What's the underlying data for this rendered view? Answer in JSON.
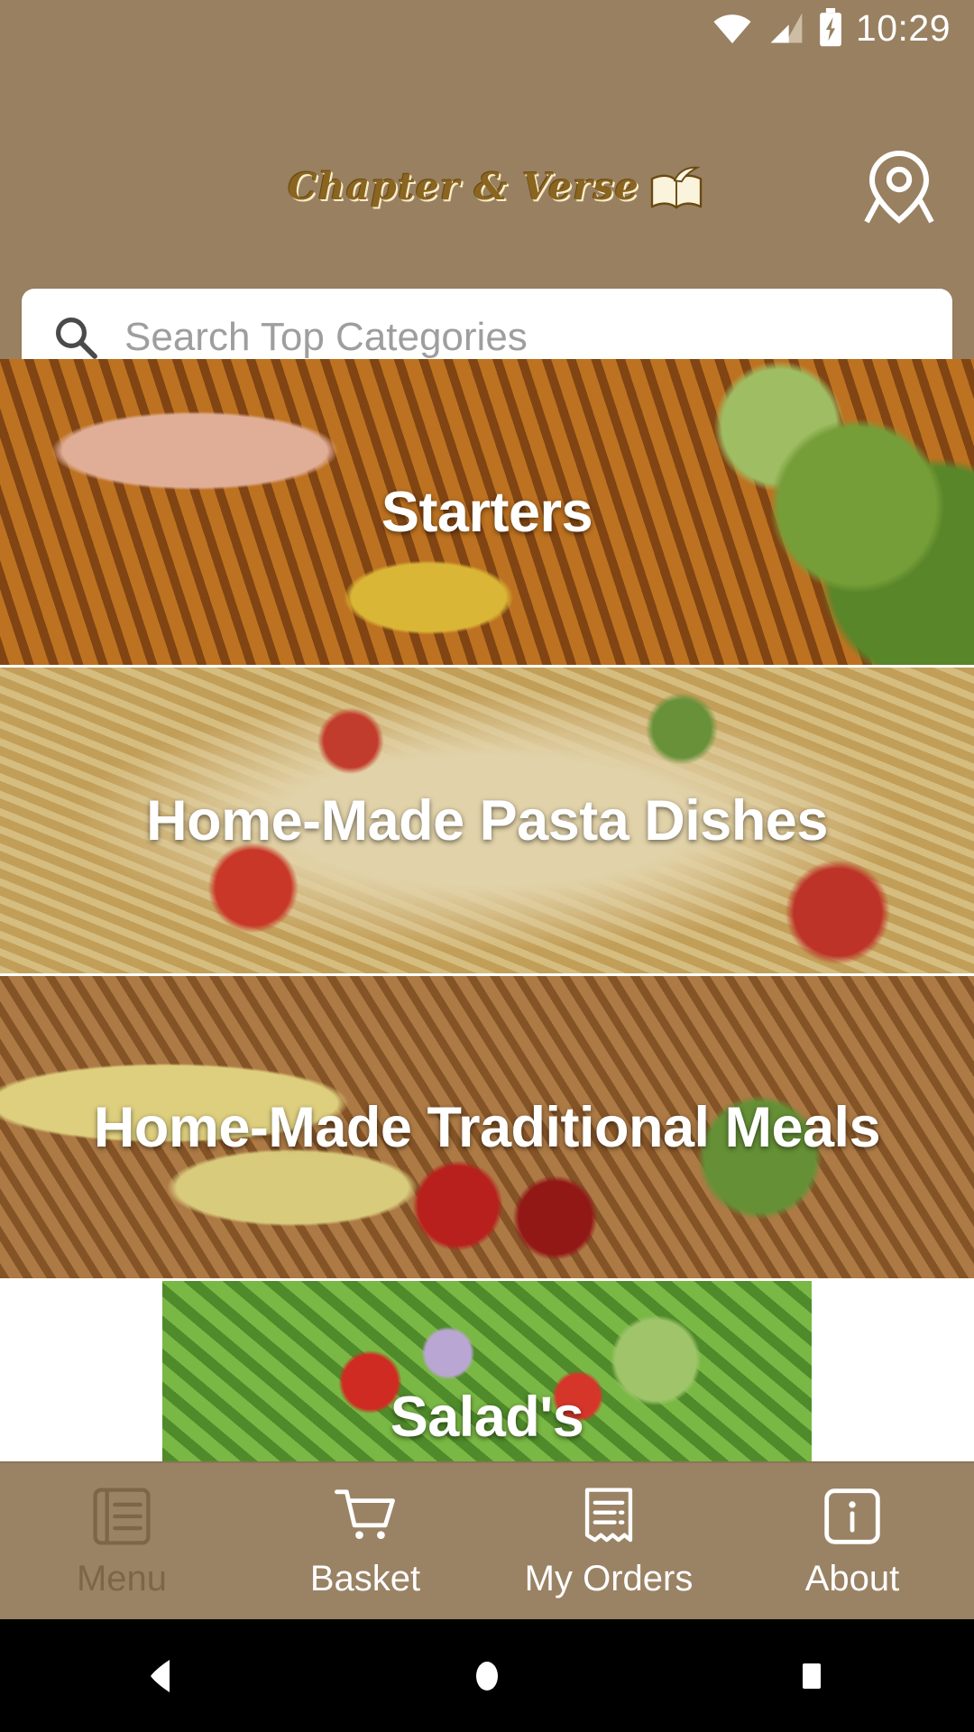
{
  "status_bar": {
    "time": "10:29",
    "icons": [
      "wifi-icon",
      "cellular-signal-icon",
      "battery-charging-icon"
    ]
  },
  "header": {
    "brand_name": "Chapter & Verse",
    "brand_icon": "open-book-quill-icon",
    "location_icon": "location-pin-icon",
    "background_color": "#988061",
    "brand_color": "#8a6520"
  },
  "search": {
    "icon": "search-icon",
    "placeholder": "Search Top Categories",
    "value": ""
  },
  "categories": [
    {
      "label": "Starters",
      "photo": "grilled-prawns-plate"
    },
    {
      "label": "Home-Made Pasta Dishes",
      "photo": "pasta-plate"
    },
    {
      "label": "Home-Made Traditional Meals",
      "photo": "traditional-meal-plate"
    },
    {
      "label": "Salad's",
      "photo": "green-salad-bowl"
    }
  ],
  "bottom_nav": [
    {
      "label": "Menu",
      "icon": "menu-book-icon",
      "state": "inactive"
    },
    {
      "label": "Basket",
      "icon": "shopping-cart-icon",
      "state": "active"
    },
    {
      "label": "My Orders",
      "icon": "receipt-icon",
      "state": "active"
    },
    {
      "label": "About",
      "icon": "info-icon",
      "state": "active"
    }
  ],
  "android_nav": {
    "back": "back-triangle-icon",
    "home": "home-circle-icon",
    "recents": "recents-square-icon"
  }
}
